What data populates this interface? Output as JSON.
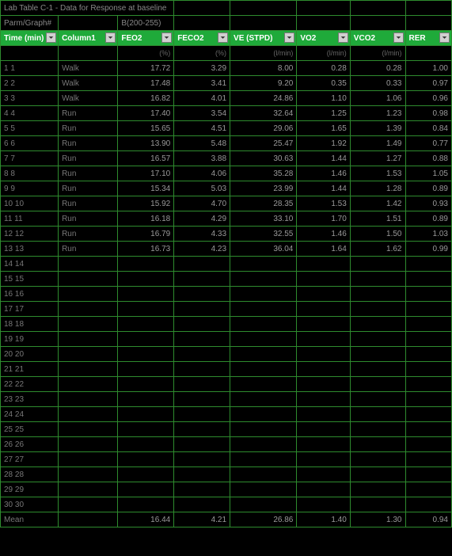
{
  "title_row": [
    "Lab Table C-1 - Data for Response at baseline",
    "",
    "",
    "",
    "",
    "",
    "",
    ""
  ],
  "param_row": [
    "Parm/Graph#",
    "",
    "B(200-255)",
    "",
    "",
    "",
    "",
    ""
  ],
  "headers": [
    "Time (min)",
    "Column1",
    "FEO2",
    "FECO2",
    "VE (STPD)",
    "VO2",
    "VCO2",
    "RER"
  ],
  "units": [
    "",
    "",
    "(%)",
    "(%)",
    "(l/min)",
    "(l/min)",
    "(l/min)",
    ""
  ],
  "rows": [
    {
      "i": "1 1",
      "c": "Walk",
      "v": [
        "17.72",
        "3.29",
        "8.00",
        "0.28",
        "0.28",
        "1.00"
      ]
    },
    {
      "i": "2 2",
      "c": "Walk",
      "v": [
        "17.48",
        "3.41",
        "9.20",
        "0.35",
        "0.33",
        "0.97"
      ]
    },
    {
      "i": "3 3",
      "c": "Walk",
      "v": [
        "16.82",
        "4.01",
        "24.86",
        "1.10",
        "1.06",
        "0.96"
      ]
    },
    {
      "i": "4 4",
      "c": "Run",
      "v": [
        "17.40",
        "3.54",
        "32.64",
        "1.25",
        "1.23",
        "0.98"
      ]
    },
    {
      "i": "5 5",
      "c": "Run",
      "v": [
        "15.65",
        "4.51",
        "29.06",
        "1.65",
        "1.39",
        "0.84"
      ]
    },
    {
      "i": "6 6",
      "c": "Run",
      "v": [
        "13.90",
        "5.48",
        "25.47",
        "1.92",
        "1.49",
        "0.77"
      ]
    },
    {
      "i": "7 7",
      "c": "Run",
      "v": [
        "16.57",
        "3.88",
        "30.63",
        "1.44",
        "1.27",
        "0.88"
      ]
    },
    {
      "i": "8 8",
      "c": "Run",
      "v": [
        "17.10",
        "4.06",
        "35.28",
        "1.46",
        "1.53",
        "1.05"
      ]
    },
    {
      "i": "9 9",
      "c": "Run",
      "v": [
        "15.34",
        "5.03",
        "23.99",
        "1.44",
        "1.28",
        "0.89"
      ]
    },
    {
      "i": "10 10",
      "c": "Run",
      "v": [
        "15.92",
        "4.70",
        "28.35",
        "1.53",
        "1.42",
        "0.93"
      ]
    },
    {
      "i": "11 11",
      "c": "Run",
      "v": [
        "16.18",
        "4.29",
        "33.10",
        "1.70",
        "1.51",
        "0.89"
      ]
    },
    {
      "i": "12 12",
      "c": "Run",
      "v": [
        "16.79",
        "4.33",
        "32.55",
        "1.46",
        "1.50",
        "1.03"
      ]
    },
    {
      "i": "13 13",
      "c": "Run",
      "v": [
        "16.73",
        "4.23",
        "36.04",
        "1.64",
        "1.62",
        "0.99"
      ]
    },
    {
      "i": "14 14",
      "c": "",
      "v": [
        "",
        "",
        "",
        "",
        "",
        ""
      ]
    },
    {
      "i": "15 15",
      "c": "",
      "v": [
        "",
        "",
        "",
        "",
        "",
        ""
      ]
    },
    {
      "i": "16 16",
      "c": "",
      "v": [
        "",
        "",
        "",
        "",
        "",
        ""
      ]
    },
    {
      "i": "17 17",
      "c": "",
      "v": [
        "",
        "",
        "",
        "",
        "",
        ""
      ]
    },
    {
      "i": "18 18",
      "c": "",
      "v": [
        "",
        "",
        "",
        "",
        "",
        ""
      ]
    },
    {
      "i": "19 19",
      "c": "",
      "v": [
        "",
        "",
        "",
        "",
        "",
        ""
      ]
    },
    {
      "i": "20 20",
      "c": "",
      "v": [
        "",
        "",
        "",
        "",
        "",
        ""
      ]
    },
    {
      "i": "21 21",
      "c": "",
      "v": [
        "",
        "",
        "",
        "",
        "",
        ""
      ]
    },
    {
      "i": "22 22",
      "c": "",
      "v": [
        "",
        "",
        "",
        "",
        "",
        ""
      ]
    },
    {
      "i": "23 23",
      "c": "",
      "v": [
        "",
        "",
        "",
        "",
        "",
        ""
      ]
    },
    {
      "i": "24 24",
      "c": "",
      "v": [
        "",
        "",
        "",
        "",
        "",
        ""
      ]
    },
    {
      "i": "25 25",
      "c": "",
      "v": [
        "",
        "",
        "",
        "",
        "",
        ""
      ]
    },
    {
      "i": "26 26",
      "c": "",
      "v": [
        "",
        "",
        "",
        "",
        "",
        ""
      ]
    },
    {
      "i": "27 27",
      "c": "",
      "v": [
        "",
        "",
        "",
        "",
        "",
        ""
      ]
    },
    {
      "i": "28 28",
      "c": "",
      "v": [
        "",
        "",
        "",
        "",
        "",
        ""
      ]
    },
    {
      "i": "29 29",
      "c": "",
      "v": [
        "",
        "",
        "",
        "",
        "",
        ""
      ]
    },
    {
      "i": "30 30",
      "c": "",
      "v": [
        "",
        "",
        "",
        "",
        "",
        ""
      ]
    }
  ],
  "footer": {
    "i": "Mean",
    "c": "",
    "v": [
      "16.44",
      "4.21",
      "26.86",
      "1.40",
      "1.30",
      "0.94"
    ]
  },
  "chart_data": {
    "type": "table",
    "title": "Lab Table C-1 - Data for Response at baseline",
    "columns": [
      "Time (min)",
      "Column1",
      "FEO2 (%)",
      "FECO2 (%)",
      "VE (STPD) (l/min)",
      "VO2 (l/min)",
      "VCO2 (l/min)",
      "RER"
    ],
    "data": [
      [
        1,
        "Walk",
        17.72,
        3.29,
        8.0,
        0.28,
        0.28,
        1.0
      ],
      [
        2,
        "Walk",
        17.48,
        3.41,
        9.2,
        0.35,
        0.33,
        0.97
      ],
      [
        3,
        "Walk",
        16.82,
        4.01,
        24.86,
        1.1,
        1.06,
        0.96
      ],
      [
        4,
        "Run",
        17.4,
        3.54,
        32.64,
        1.25,
        1.23,
        0.98
      ],
      [
        5,
        "Run",
        15.65,
        4.51,
        29.06,
        1.65,
        1.39,
        0.84
      ],
      [
        6,
        "Run",
        13.9,
        5.48,
        25.47,
        1.92,
        1.49,
        0.77
      ],
      [
        7,
        "Run",
        16.57,
        3.88,
        30.63,
        1.44,
        1.27,
        0.88
      ],
      [
        8,
        "Run",
        17.1,
        4.06,
        35.28,
        1.46,
        1.53,
        1.05
      ],
      [
        9,
        "Run",
        15.34,
        5.03,
        23.99,
        1.44,
        1.28,
        0.89
      ],
      [
        10,
        "Run",
        15.92,
        4.7,
        28.35,
        1.53,
        1.42,
        0.93
      ],
      [
        11,
        "Run",
        16.18,
        4.29,
        33.1,
        1.7,
        1.51,
        0.89
      ],
      [
        12,
        "Run",
        16.79,
        4.33,
        32.55,
        1.46,
        1.5,
        1.03
      ],
      [
        13,
        "Run",
        16.73,
        4.23,
        36.04,
        1.64,
        1.62,
        0.99
      ]
    ],
    "summary": [
      "Mean",
      "",
      16.44,
      4.21,
      26.86,
      1.4,
      1.3,
      0.94
    ]
  }
}
